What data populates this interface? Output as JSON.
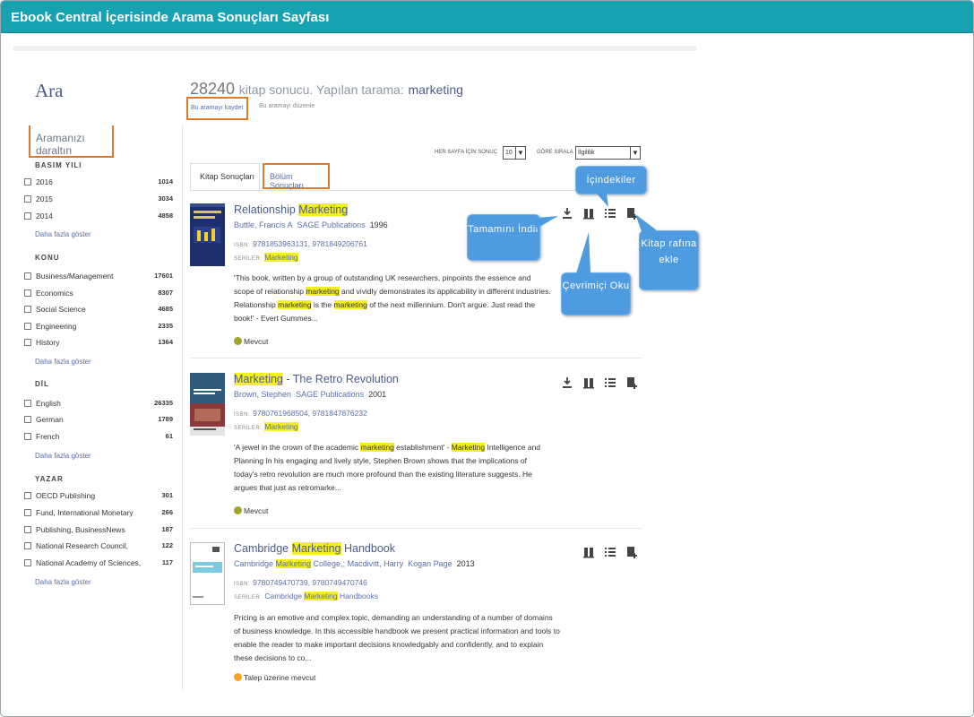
{
  "window": {
    "title": "Ebook Central İçerisinde Arama Sonuçları Sayfası"
  },
  "sidebar": {
    "heading": "Ara",
    "narrow_label": "Aramanızı daraltın",
    "more_label": "Daha fazla göster",
    "facets": [
      {
        "title": "BASIM YILI",
        "items": [
          {
            "label": "2016",
            "count": "1014"
          },
          {
            "label": "2015",
            "count": "3034"
          },
          {
            "label": "2014",
            "count": "4858"
          }
        ]
      },
      {
        "title": "KONU",
        "items": [
          {
            "label": "Business/Management",
            "count": "17601"
          },
          {
            "label": "Economics",
            "count": "8307"
          },
          {
            "label": "Social Science",
            "count": "4685"
          },
          {
            "label": "Engineering",
            "count": "2335"
          },
          {
            "label": "History",
            "count": "1364"
          }
        ]
      },
      {
        "title": "DİL",
        "items": [
          {
            "label": "English",
            "count": "26335"
          },
          {
            "label": "German",
            "count": "1789"
          },
          {
            "label": "French",
            "count": "61"
          }
        ]
      },
      {
        "title": "YAZAR",
        "items": [
          {
            "label": "OECD Publishing",
            "count": "301"
          },
          {
            "label": "Fund, International Monetary",
            "count": "266"
          },
          {
            "label": "Publishing, BusinessNews",
            "count": "187"
          },
          {
            "label": "National Research Council,",
            "count": "122"
          },
          {
            "label": "National Academy of Sciences,",
            "count": "117"
          }
        ]
      }
    ]
  },
  "results_header": {
    "count": "28240",
    "text": "kitap sonucu. Yapılan tarama:",
    "keyword": "marketing",
    "save_search": "Bu aramayı kaydet",
    "edit_search": "Bu aramayı düzenle",
    "per_page_label": "HER SAYFA İÇİN SONUÇ",
    "per_page_value": "10",
    "sort_label": "GÖRE SIRALA",
    "sort_value": "İlgililik"
  },
  "tabs": [
    {
      "label": "Kitap Sonuçları"
    },
    {
      "label": "Bölüm Sonuçları"
    }
  ],
  "labels": {
    "isbn": "ISBN:",
    "series": "SERİLER:"
  },
  "results": [
    {
      "title_pre": "Relationship ",
      "title_hl": "Marketing",
      "title_post": "",
      "author": "Buttle, Francis A",
      "publisher": "SAGE Publications",
      "year": "1996",
      "isbn": "9781853963131, 9781849206761",
      "series_pre": "",
      "series_hl": "Marketing",
      "series_post": "",
      "description": [
        {
          "t": "'This book, written by a group of outstanding UK researchers, pinpoints the essence and scope of relationship "
        },
        {
          "h": "marketing"
        },
        {
          "t": " and vividly demonstrates its applicability in different industries. Relationship "
        },
        {
          "h": "marketing"
        },
        {
          "t": " is the "
        },
        {
          "h": "marketing"
        },
        {
          "t": " of the next millennium. Don't argue. Just read the book!' - Evert Gummes..."
        }
      ],
      "availability": "Mevcut",
      "availability_color": "#9fa52a"
    },
    {
      "title_pre": "",
      "title_hl": "Marketing",
      "title_post": " - The Retro Revolution",
      "author": "Brown, Stephen",
      "publisher": "SAGE Publications",
      "year": "2001",
      "isbn": "9780761968504, 9781847876232",
      "series_pre": "",
      "series_hl": "Marketing",
      "series_post": "",
      "description": [
        {
          "t": "'A jewel in the crown of the academic "
        },
        {
          "h": "marketing"
        },
        {
          "t": " establishment' - "
        },
        {
          "h": "Marketing"
        },
        {
          "t": " Intelligence and Planning In his engaging and lively style, Stephen Brown shows that the implications of today's retro revolution are much more profound than the existing literature suggests. He argues that just as retromarke..."
        }
      ],
      "availability": "Mevcut",
      "availability_color": "#9fa52a"
    },
    {
      "title_pre": "Cambridge ",
      "title_hl": "Marketing",
      "title_post": " Handbook",
      "author_pre": "Cambridge ",
      "author_hl": "Marketing",
      "author_post": " College,; Macdivitt, Harry",
      "publisher": "Kogan Page",
      "year": "2013",
      "isbn": "9780749470739, 9780749470746",
      "series_pre": "Cambridge ",
      "series_hl": "Marketing",
      "series_post": " Handbooks",
      "description": [
        {
          "t": "Pricing is an emotive and complex topic, demanding an understanding of a number of domains of business knowledge. In this accessible handbook we present practical information and tools to enable the reader to make important decisions knowledgably and confidently, and to explain these decisions to co..."
        }
      ],
      "availability": "Talep üzerine mevcut",
      "availability_color": "#f3a623"
    }
  ],
  "callouts": {
    "download": "Tamamını İndir",
    "contents": "İçindekiler",
    "read_online": "Çevrimiçi Oku",
    "add_shelf": "Kitap rafına ekle"
  },
  "colors": {
    "titlebar": "#17a2b2",
    "highlight": "#f3ef24",
    "callout": "#4f9be0",
    "annotation_box": "#e07a2b",
    "link": "#4b5c88"
  }
}
